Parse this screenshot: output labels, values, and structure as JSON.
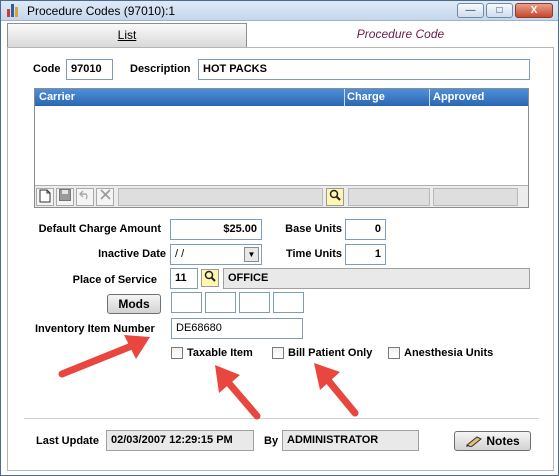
{
  "window": {
    "title": "Procedure Codes (97010):1"
  },
  "titlebar_buttons": {
    "minimize": "—",
    "maximize": "□",
    "close": "X"
  },
  "tabs": {
    "list_label": "List",
    "active_label": "Procedure Code"
  },
  "form": {
    "code_label": "Code",
    "code_value": "97010",
    "description_label": "Description",
    "description_value": "HOT PACKS"
  },
  "grid": {
    "columns": [
      "Carrier",
      "Charge",
      "Approved"
    ]
  },
  "toolbar_icons": [
    "new-document-icon",
    "save-icon",
    "undo-icon",
    "delete-icon"
  ],
  "charges": {
    "default_charge_label": "Default Charge Amount",
    "default_charge_value": "$25.00",
    "base_units_label": "Base Units",
    "base_units_value": "0",
    "inactive_date_label": "Inactive Date",
    "inactive_date_value": " /  /",
    "time_units_label": "Time Units",
    "time_units_value": "1",
    "place_of_service_label": "Place of Service",
    "place_of_service_code": "11",
    "place_of_service_name": "OFFICE",
    "mods_label": "Mods",
    "inventory_label": "Inventory Item Number",
    "inventory_value": "DE68680"
  },
  "checkboxes": {
    "taxable_label": "Taxable Item",
    "bill_patient_label": "Bill Patient Only",
    "anesthesia_label": "Anesthesia Units"
  },
  "footer": {
    "last_update_label": "Last Update",
    "last_update_value": "02/03/2007 12:29:15 PM",
    "by_label": "By",
    "by_value": "ADMINISTRATOR",
    "notes_label": "Notes"
  },
  "colors": {
    "arrow": "#e8463e",
    "grid_header": "#2a66b2",
    "lookup": "#fff7b0"
  }
}
